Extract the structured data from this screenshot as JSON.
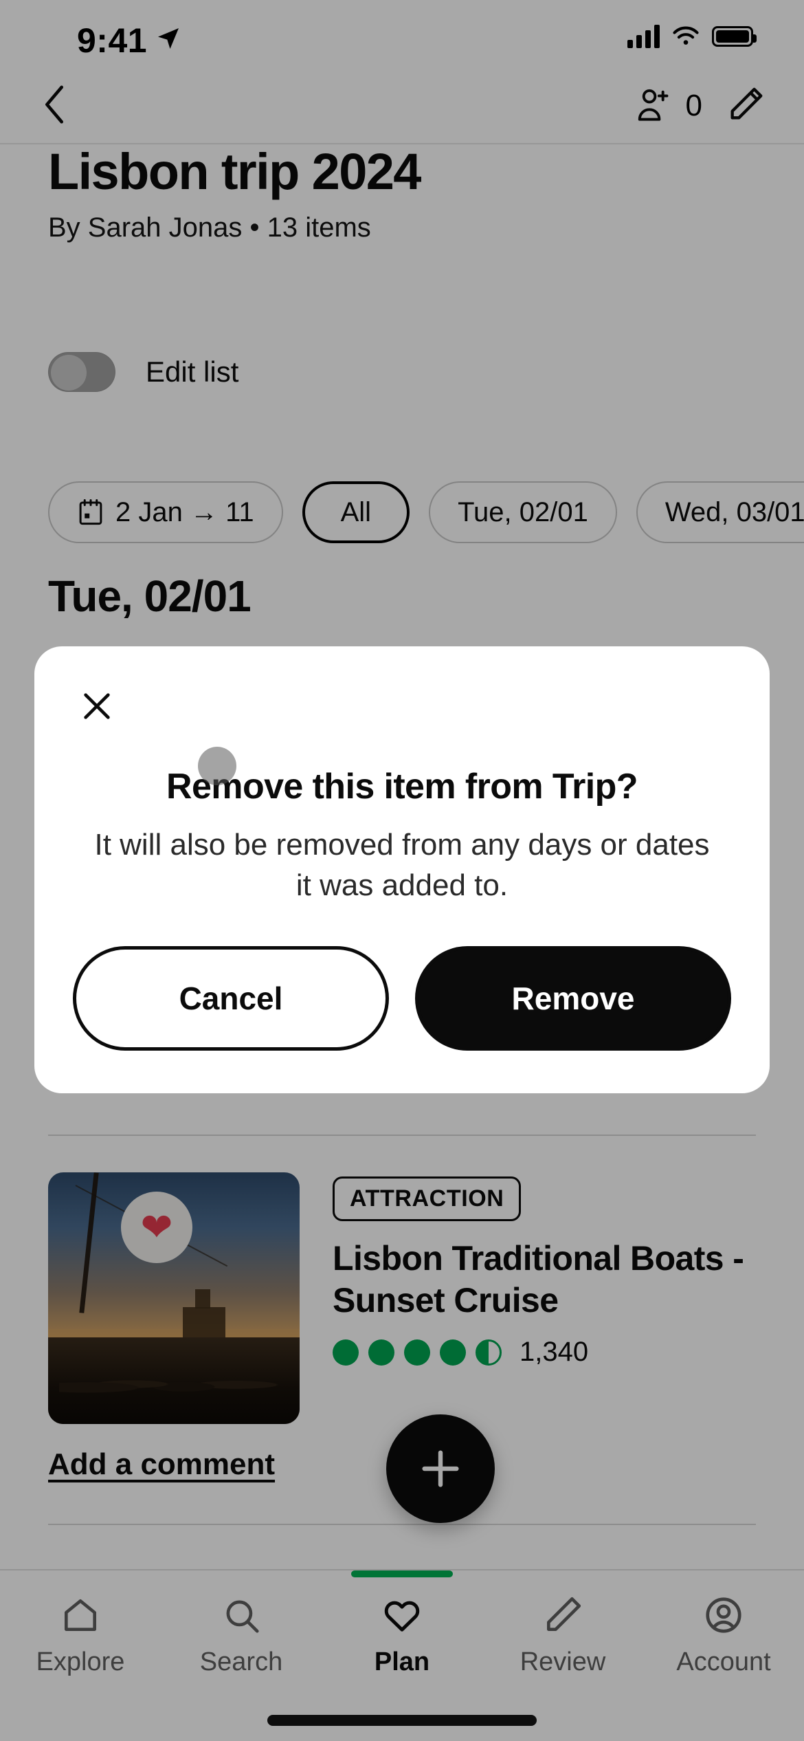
{
  "status_bar": {
    "time": "9:41",
    "location_icon": "location-arrow-icon",
    "cellular_icon": "cellular-bars-icon",
    "wifi_icon": "wifi-icon",
    "battery_icon": "battery-full-icon"
  },
  "nav": {
    "back_icon": "chevron-left-icon",
    "add_person_icon": "person-add-icon",
    "collaborator_count": "0",
    "edit_icon": "pencil-icon"
  },
  "header": {
    "title": "Lisbon trip 2024",
    "subtitle": "By Sarah Jonas • 13 items"
  },
  "edit_toggle": {
    "label": "Edit list",
    "state": "off"
  },
  "filters": {
    "chips": [
      {
        "label": "2 Jan → 11",
        "icon": "calendar-icon",
        "selected": false
      },
      {
        "label": "All",
        "icon": "",
        "selected": true
      },
      {
        "label": "Tue, 02/01",
        "icon": "",
        "selected": false
      },
      {
        "label": "Wed, 03/01",
        "icon": "",
        "selected": false
      }
    ]
  },
  "day_section": {
    "heading": "Tue, 02/01"
  },
  "item_card": {
    "badge": "ATTRACTION",
    "title": "Lisbon Traditional Boats - Sunset Cruise",
    "rating_value": 4.5,
    "rating_max": 5,
    "review_count": "1,340",
    "favorite_icon": "heart-icon",
    "favorite_color": "#e23b4e",
    "rating_color": "#00a451",
    "add_comment": "Add a comment"
  },
  "fab": {
    "icon": "plus-icon",
    "label": "+"
  },
  "modal": {
    "close_icon": "close-icon",
    "title": "Remove this item from Trip?",
    "body": "It will also be removed from any days or dates it was added to.",
    "cancel_label": "Cancel",
    "confirm_label": "Remove"
  },
  "tab_bar": {
    "active_indicator_color": "#00b053",
    "tabs": [
      {
        "label": "Explore",
        "icon": "home-icon",
        "active": false
      },
      {
        "label": "Search",
        "icon": "search-icon",
        "active": false
      },
      {
        "label": "Plan",
        "icon": "heart-outline-icon",
        "active": true
      },
      {
        "label": "Review",
        "icon": "pencil-icon",
        "active": false
      },
      {
        "label": "Account",
        "icon": "account-circle-icon",
        "active": false
      }
    ]
  }
}
